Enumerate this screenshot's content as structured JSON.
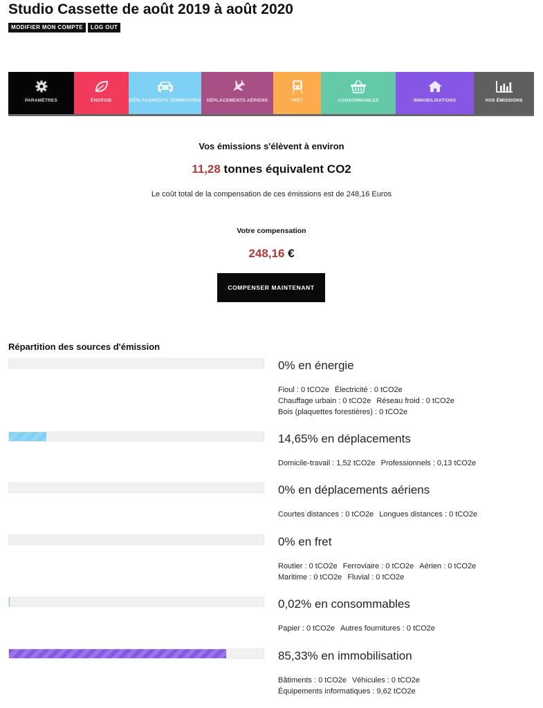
{
  "header": {
    "title": "Studio Cassette de août 2019 à août 2020",
    "modify_account": "MODIFIER MON COMPTE",
    "logout": "LOG OUT"
  },
  "nav": {
    "items": [
      {
        "label": "PARAMÈTRES",
        "icon": "gear-icon",
        "bg": "#050505",
        "fg": "#dddddd"
      },
      {
        "label": "ÉNERGIE",
        "icon": "leaf-icon",
        "bg": "#f23b5c",
        "fg": "#ffe6ea"
      },
      {
        "label": "DÉPLACEMENTS TERRESTRES",
        "icon": "car-icon",
        "bg": "#7ed0f4",
        "fg": "#e8f7fd"
      },
      {
        "label": "DÉPLACEMENTS AÉRIENS",
        "icon": "plane-icon",
        "bg": "#a84f86",
        "fg": "#f5dceb"
      },
      {
        "label": "FRÊT",
        "icon": "train-icon",
        "bg": "#fcab4d",
        "fg": "#fff3e3"
      },
      {
        "label": "CONSOMMABLES",
        "icon": "basket-icon",
        "bg": "#63c9a8",
        "fg": "#e6f8f2"
      },
      {
        "label": "IMMOBILISATIONS",
        "icon": "house-icon",
        "bg": "#8657e4",
        "fg": "#efe8fc"
      },
      {
        "label": "VOS ÉMISSIONS",
        "icon": "bar-chart-icon",
        "bg": "#5f5f5f",
        "fg": "#ffffff"
      }
    ]
  },
  "summary": {
    "intro": "Vos émissions s'élèvent à environ",
    "total_value": "11,28",
    "total_unit": " tonnes équivalent CO2",
    "cost_text": "Le coût total de la compensation de ces émissions est de 248,16 Euros",
    "compensation_label": "Votre compensation",
    "compensation_value": "248,16",
    "compensation_currency": " €",
    "compensate_button": "COMPENSER MAINTENANT"
  },
  "breakdown": {
    "title": "Répartition des sources d'émission",
    "categories": [
      {
        "heading": "0% en énergie",
        "percent": 0,
        "color": "#f23b5c",
        "lines": [
          [
            "Fioul : 0 tCO2e",
            "Électricité : 0 tCO2e"
          ],
          [
            "Chauffage urbain : 0 tCO2e",
            "Réseau froid : 0 tCO2e"
          ],
          [
            "Bois (plaquettes forestières) : 0 tCO2e"
          ]
        ]
      },
      {
        "heading": "14,65% en déplacements",
        "percent": 14.65,
        "color": "#7ed0f4",
        "lines": [
          [
            "Domicile-travail : 1,52 tCO2e",
            "Professionnels : 0,13 tCO2e"
          ]
        ]
      },
      {
        "heading": "0% en déplacements aériens",
        "percent": 0,
        "color": "#a84f86",
        "lines": [
          [
            "Courtes distances : 0 tCO2e",
            "Longues distances : 0 tCO2e"
          ]
        ]
      },
      {
        "heading": "0% en fret",
        "percent": 0,
        "color": "#fcab4d",
        "lines": [
          [
            "Routier : 0 tCO2e",
            "Ferroviaire : 0 tCO2e",
            "Aérien : 0 tCO2e"
          ],
          [
            "Maritime : 0 tCO2e",
            "Fluvial : 0 tCO2e"
          ]
        ]
      },
      {
        "heading": "0,02% en consommables",
        "percent": 0.02,
        "color": "#63c9a8",
        "lines": [
          [
            "Papier : 0 tCO2e",
            "Autres fournitures : 0 tCO2e"
          ]
        ]
      },
      {
        "heading": "85,33% en immobilisation",
        "percent": 85.33,
        "color": "#8657e4",
        "lines": [
          [
            "Bâtiments : 0 tCO2e",
            "Véhicules : 0 tCO2e"
          ],
          [
            "Équipements informatiques : 9,62 tCO2e"
          ]
        ]
      }
    ]
  }
}
